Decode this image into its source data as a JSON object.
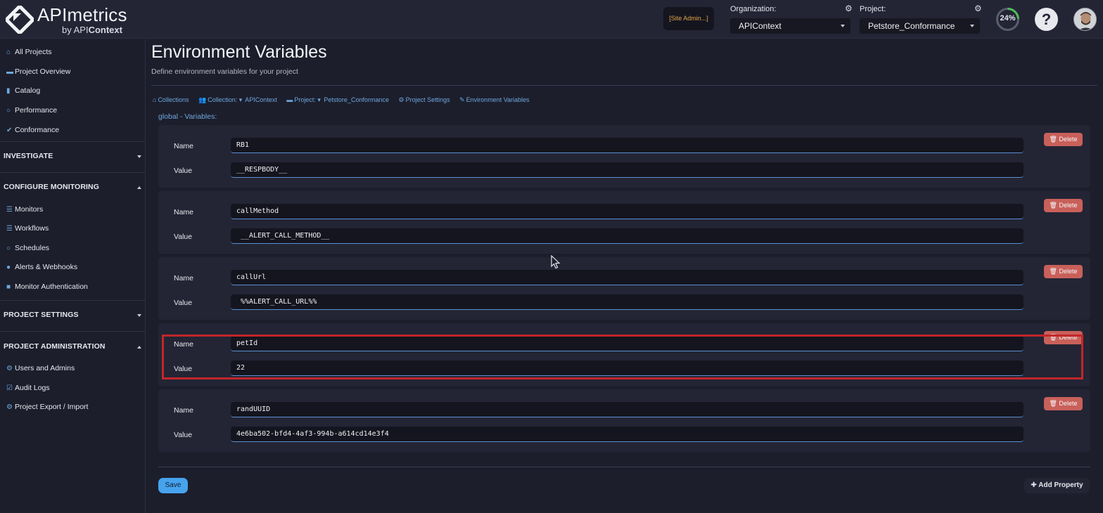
{
  "header": {
    "logo_title": "APImetrics",
    "logo_by": "by API",
    "logo_context": "Context",
    "site_admin": "[Site Admin...]",
    "organization_label": "Organization:",
    "organization_value": "APIContext",
    "project_label": "Project:",
    "project_value": "Petstore_Conformance",
    "progress_text": "24%",
    "progress_percent": 24,
    "help_label": "?"
  },
  "sidebar": {
    "top_items": [
      {
        "icon": "home-icon",
        "label": "All Projects"
      },
      {
        "icon": "folder-open-icon",
        "label": "Project Overview"
      },
      {
        "icon": "book-icon",
        "label": "Catalog"
      },
      {
        "icon": "dashboard-icon",
        "label": "Performance"
      },
      {
        "icon": "check-icon",
        "label": "Conformance"
      }
    ],
    "investigate": "INVESTIGATE",
    "configure_monitoring": "CONFIGURE MONITORING",
    "monitoring_items": [
      {
        "icon": "list-icon",
        "label": "Monitors"
      },
      {
        "icon": "workflow-icon",
        "label": "Workflows"
      },
      {
        "icon": "clock-icon",
        "label": "Schedules"
      },
      {
        "icon": "bell-icon",
        "label": "Alerts & Webhooks"
      },
      {
        "icon": "lock-icon",
        "label": "Monitor Authentication"
      }
    ],
    "project_settings": "PROJECT SETTINGS",
    "project_administration": "PROJECT ADMINISTRATION",
    "admin_items": [
      {
        "icon": "gear-icon",
        "label": "Users and Admins"
      },
      {
        "icon": "audit-icon",
        "label": "Audit Logs"
      },
      {
        "icon": "gear-icon",
        "label": "Project Export / Import"
      }
    ]
  },
  "main": {
    "title": "Environment Variables",
    "subtitle": "Define environment variables for your project",
    "breadcrumb": {
      "collections": "Collections",
      "collection": "Collection:",
      "collection_value": "APIContext",
      "project": "Project:",
      "project_value": "Petstore_Conformance",
      "project_settings": "Project Settings",
      "environment_variables": "Environment Variables"
    },
    "section_label": "global - Variables:",
    "name_label": "Name",
    "value_label": "Value",
    "delete_label": "Delete",
    "variables": [
      {
        "name": "RB1",
        "value": "__RESPBODY__"
      },
      {
        "name": "callMethod",
        "value": " __ALERT_CALL_METHOD__"
      },
      {
        "name": "callUrl",
        "value": " %%ALERT_CALL_URL%%"
      },
      {
        "name": "petId",
        "value": "22"
      },
      {
        "name": "randUUID",
        "value": "4e6ba502-bfd4-4af3-994b-a614cd14e3f4"
      }
    ],
    "save_label": "Save",
    "add_property_label": "Add Property"
  }
}
